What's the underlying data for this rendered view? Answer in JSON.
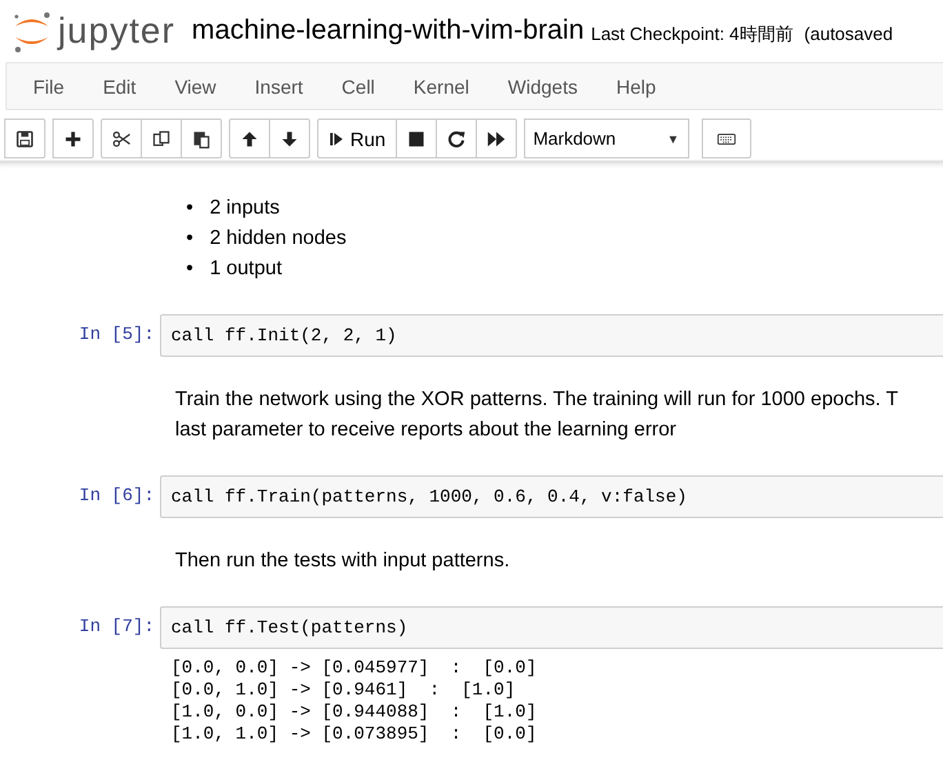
{
  "header": {
    "logo": "jupyter",
    "notebook_name": "machine-learning-with-vim-brain",
    "checkpoint": "Last Checkpoint: 4時間前",
    "autosave": "(autosaved"
  },
  "menu": [
    "File",
    "Edit",
    "View",
    "Insert",
    "Cell",
    "Kernel",
    "Widgets",
    "Help"
  ],
  "toolbar": {
    "run_label": "Run",
    "cell_type": "Markdown",
    "caret": "▼"
  },
  "cells": [
    {
      "kind": "markdown",
      "items": [
        {
          "marker": "•",
          "text": "2 inputs"
        },
        {
          "marker": "•",
          "text": "2 hidden nodes"
        },
        {
          "marker": "•",
          "text": "1 output"
        }
      ]
    },
    {
      "kind": "code",
      "prompt": "In [5]:",
      "source": "call ff.Init(2, 2, 1)"
    },
    {
      "kind": "markdown",
      "lines": [
        "Train the network using the XOR patterns. The training will run for 1000 epochs. T",
        "last parameter to receive reports about the learning error"
      ]
    },
    {
      "kind": "code",
      "prompt": "In [6]:",
      "source": "call ff.Train(patterns, 1000, 0.6, 0.4, v:false)"
    },
    {
      "kind": "markdown",
      "lines": [
        "Then run the tests with input patterns."
      ]
    },
    {
      "kind": "code",
      "prompt": "In [7]:",
      "source": "call ff.Test(patterns)",
      "output": [
        "[0.0, 0.0] -> [0.045977]  :  [0.0]",
        "[0.0, 1.0] -> [0.9461]  :  [1.0]",
        "[1.0, 0.0] -> [0.944088]  :  [1.0]",
        "[1.0, 1.0] -> [0.073895]  :  [0.0]"
      ]
    }
  ]
}
